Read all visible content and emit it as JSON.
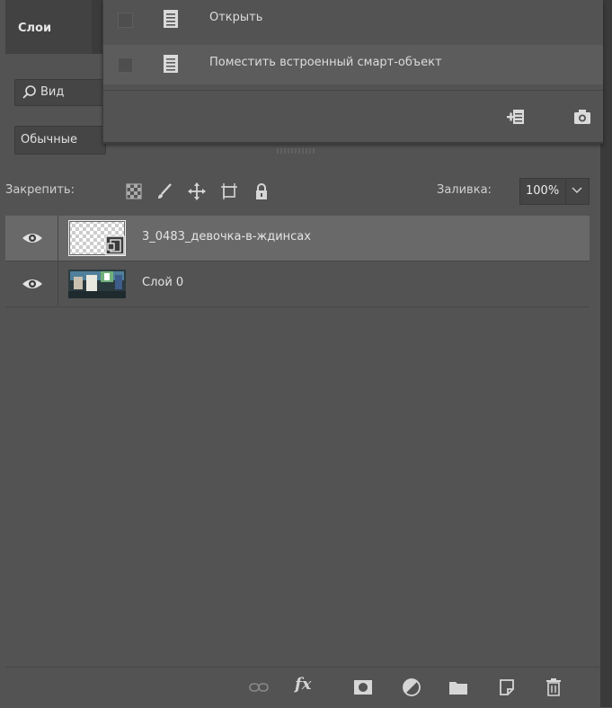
{
  "panel": {
    "tab_title": "Слои"
  },
  "filter": {
    "search_label": "Вид",
    "blend_mode": "Обычные"
  },
  "menu": {
    "items": [
      {
        "label": "Открыть",
        "icon": "document-icon"
      },
      {
        "label": "Поместить встроенный смарт-объект",
        "icon": "document-icon"
      }
    ],
    "footer_icons": [
      "place-embedded-icon",
      "camera-icon"
    ]
  },
  "lock": {
    "label": "Закрепить:",
    "icons": [
      "lock-transparent-pixels-icon",
      "brush-icon",
      "move-icon",
      "artboard-icon",
      "lock-icon"
    ]
  },
  "fill": {
    "label": "Заливка:",
    "value": "100%"
  },
  "layers": [
    {
      "name": "3_0483_девочка-в-ждинсах",
      "visible": true,
      "selected": true,
      "type": "smart-object"
    },
    {
      "name": "Слой 0",
      "visible": true,
      "selected": false,
      "type": "raster"
    }
  ],
  "bottom_toolbar": [
    "link-layers-icon",
    "fx-icon",
    "layer-mask-icon",
    "adjustment-layer-icon",
    "group-folder-icon",
    "new-layer-icon",
    "trash-icon"
  ],
  "fx_label": "fx"
}
